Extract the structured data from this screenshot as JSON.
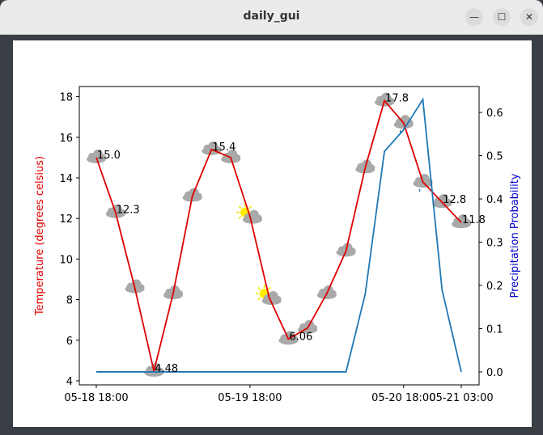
{
  "window": {
    "title": "daily_gui",
    "minimize_label": "—",
    "maximize_label": "☐",
    "close_label": "✕"
  },
  "chart_data": {
    "type": "line",
    "title": "",
    "x_ticks": [
      "05-18 18:00",
      "05-19 18:00",
      "05-20 18:00",
      "05-21 03:00"
    ],
    "x": [
      "05-18 18:00",
      "05-18 21:00",
      "05-19 00:00",
      "05-19 03:00",
      "05-19 06:00",
      "05-19 09:00",
      "05-19 12:00",
      "05-19 15:00",
      "05-19 18:00",
      "05-19 21:00",
      "05-20 00:00",
      "05-20 03:00",
      "05-20 06:00",
      "05-20 09:00",
      "05-20 12:00",
      "05-20 15:00",
      "05-20 18:00",
      "05-20 21:00",
      "05-21 00:00",
      "05-21 03:00"
    ],
    "ylabel_left": "Temperature (degrees celsius)",
    "ylabel_right": "Precipitation Probability",
    "ylim_left": [
      3.8,
      18.5
    ],
    "ylim_right": [
      -0.03,
      0.66
    ],
    "yticks_left": [
      4,
      6,
      8,
      10,
      12,
      14,
      16,
      18
    ],
    "yticks_right": [
      "0.0",
      "0.1",
      "0.2",
      "0.3",
      "0.4",
      "0.5",
      "0.6"
    ],
    "series": [
      {
        "name": "temperature",
        "axis": "left",
        "color": "#e00000",
        "values": [
          15.0,
          12.3,
          8.6,
          4.48,
          8.3,
          13.1,
          15.4,
          15.0,
          12.1,
          8.1,
          6.06,
          6.6,
          8.3,
          10.4,
          14.5,
          17.8,
          16.7,
          13.8,
          12.8,
          11.8
        ],
        "weather": [
          "cloud",
          "cloud",
          "cloud",
          "cloud",
          "cloud",
          "cloud",
          "cloud",
          "cloud",
          "sun-cloud",
          "sun-cloud",
          "cloud",
          "cloud",
          "cloud",
          "cloud",
          "cloud",
          "cloud",
          "cloud-rain",
          "cloud-rain",
          "cloud",
          "cloud"
        ],
        "labels": [
          "15.0",
          "12.3",
          "",
          "4.48",
          "",
          "",
          "15.4",
          "",
          "",
          "",
          "6.06",
          "",
          "",
          "",
          "",
          "17.8",
          "",
          "",
          "12.8",
          "11.8"
        ]
      },
      {
        "name": "precipitation",
        "axis": "right",
        "color": "#1f77b4",
        "values": [
          0,
          0,
          0,
          0,
          0,
          0,
          0,
          0,
          0,
          0,
          0,
          0,
          0,
          0,
          0.18,
          0.51,
          0.56,
          0.63,
          0.19,
          0
        ]
      }
    ],
    "grid": false
  }
}
